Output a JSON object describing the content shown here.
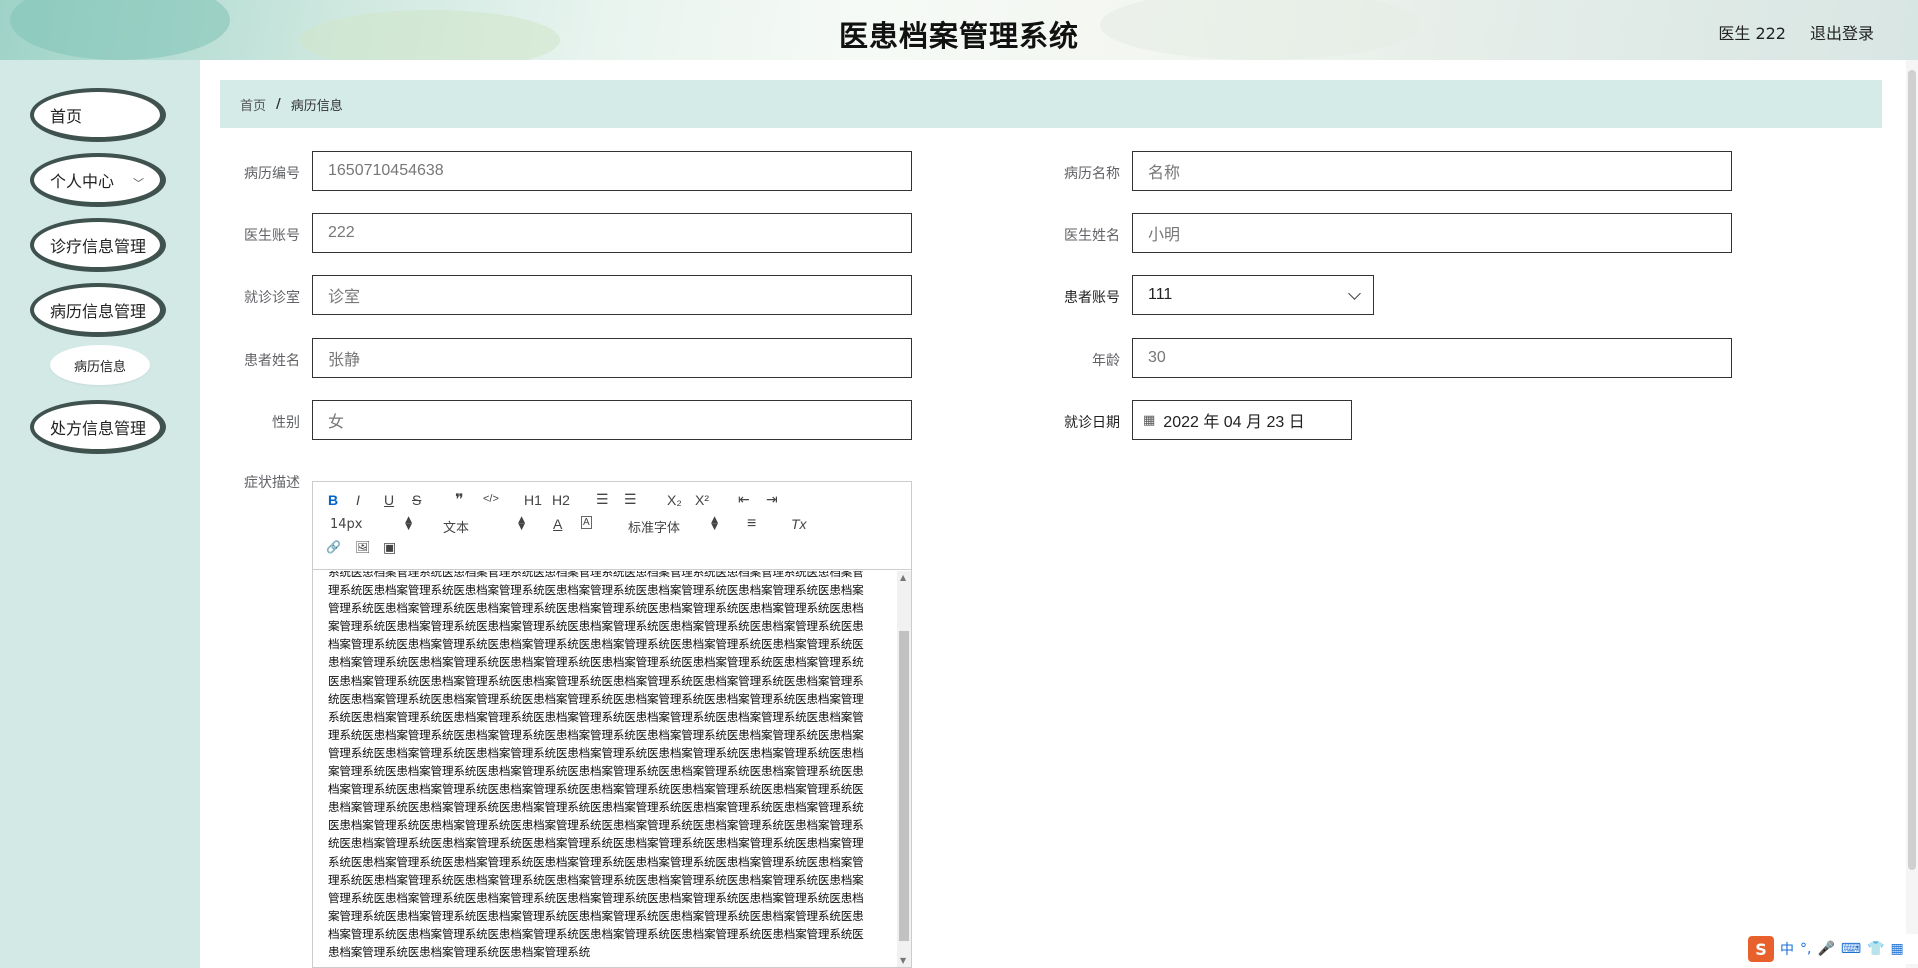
{
  "header": {
    "title": "医患档案管理系统",
    "user": "医生 222",
    "logout": "退出登录"
  },
  "sidebar": {
    "items": [
      {
        "label": "首页"
      },
      {
        "label": "个人中心"
      },
      {
        "label": "诊疗信息管理"
      },
      {
        "label": "病历信息管理"
      },
      {
        "label": "处方信息管理"
      }
    ],
    "sub_items": [
      {
        "label": "病历信息"
      }
    ]
  },
  "breadcrumb": {
    "home": "首页",
    "separator": "/",
    "current": "病历信息"
  },
  "form": {
    "record_no": {
      "label": "病历编号",
      "value": "1650710454638"
    },
    "record_name": {
      "label": "病历名称",
      "placeholder": "名称"
    },
    "doctor_account": {
      "label": "医生账号",
      "value": "222"
    },
    "doctor_name": {
      "label": "医生姓名",
      "value": "小明"
    },
    "clinic": {
      "label": "就诊诊室",
      "placeholder": "诊室"
    },
    "patient_account": {
      "label": "患者账号",
      "value": "111"
    },
    "patient_name": {
      "label": "患者姓名",
      "value": "张静"
    },
    "age": {
      "label": "年龄",
      "value": "30"
    },
    "gender": {
      "label": "性别",
      "value": "女"
    },
    "visit_date": {
      "label": "就诊日期",
      "value": "2022 年 04 月 23 日"
    },
    "symptoms": {
      "label": "症状描述",
      "content": "系统医患档案管理系统医患档案管理系统医患档案管理系统医患档案管理系统医患档案管理系统医患档案管理系统医患档案管理系统医患档案管理系统医患档案管理系统医患档案管理系统医患档案管理系统医患档案管理系统医患档案管理系统医患档案管理系统医患档案管理系统医患档案管理系统医患档案管理系统医患档案管理系统医患档案管理系统医患档案管理系统医患档案管理系统医患档案管理系统医患档案管理系统医患档案管理系统医患档案管理系统医患档案管理系统医患档案管理系统医患档案管理系统医患档案管理系统医患档案管理系统医患档案管理系统医患档案管理系统医患档案管理系统医患档案管理系统医患档案管理系统医患档案管理系统医患档案管理系统医患档案管理系统医患档案管理系统医患档案管理系统医患档案管理系统医患档案管理系统医患档案管理系统医患档案管理系统医患档案管理系统医患档案管理系统医患档案管理系统医患档案管理系统医患档案管理系统医患档案管理系统医患档案管理系统医患档案管理系统医患档案管理系统医患档案管理系统医患档案管理系统医患档案管理系统医患档案管理系统医患档案管理系统医患档案管理系统医患档案管理系统医患档案管理系统医患档案管理系统医患档案管理系统医患档案管理系统医患档案管理系统医患档案管理系统医患档案管理系统医患档案管理系统医患档案管理系统医患档案管理系统医患档案管理系统医患档案管理系统医患档案管理系统医患档案管理系统医患档案管理系统医患档案管理系统医患档案管理系统医患档案管理系统医患档案管理系统医患档案管理系统医患档案管理系统医患档案管理系统医患档案管理系统医患档案管理系统医患档案管理系统医患档案管理系统医患档案管理系统医患档案管理系统医患档案管理系统医患档案管理系统医患档案管理系统医患档案管理系统医患档案管理系统医患档案管理系统医患档案管理系统医患档案管理系统医患档案管理系统医患档案管理系统医患档案管理系统医患档案管理系统医患档案管理系统医患档案管理系统医患档案管理系统医患档案管理系统医患档案管理系统医患档案管理系统医患档案管理系统医患档案管理系统医患档案管理系统医患档案管理系统医患档案管理系统医患档案管理系统医患档案管理系统医患档案管理系统医患档案管理系统医患档案管理系统医患档案管理系统医患档案管理系统医患档案管理系统医患档案管理系统医患档案管理系统医患档案管理系统医患档案管理系统医患档案管理系统医患档案管理系统医患档案管理系统"
    }
  },
  "editor_toolbar": {
    "bold": "B",
    "italic": "I",
    "underline": "U",
    "strike": "S",
    "quote": "❞",
    "code": "</>",
    "h1": "H1",
    "h2": "H2",
    "ordered_list": "☰",
    "bullet_list": "☰",
    "subscript": "X₂",
    "superscript": "X²",
    "outdent": "⇤",
    "indent": "⇥",
    "size": "14px",
    "format": "文本",
    "font": "标准字体",
    "color": "A",
    "background": "A",
    "align": "≡",
    "clean": "Tx",
    "link": "🔗",
    "image": "🖼",
    "video": "▣"
  },
  "ime": {
    "lang": "中"
  },
  "colors": {
    "sidebar_bg": "#d3e9e6",
    "breadcrumb_bg": "#d4ebe8",
    "pill_border": "#3f524e",
    "active_tool": "#0066cc"
  }
}
